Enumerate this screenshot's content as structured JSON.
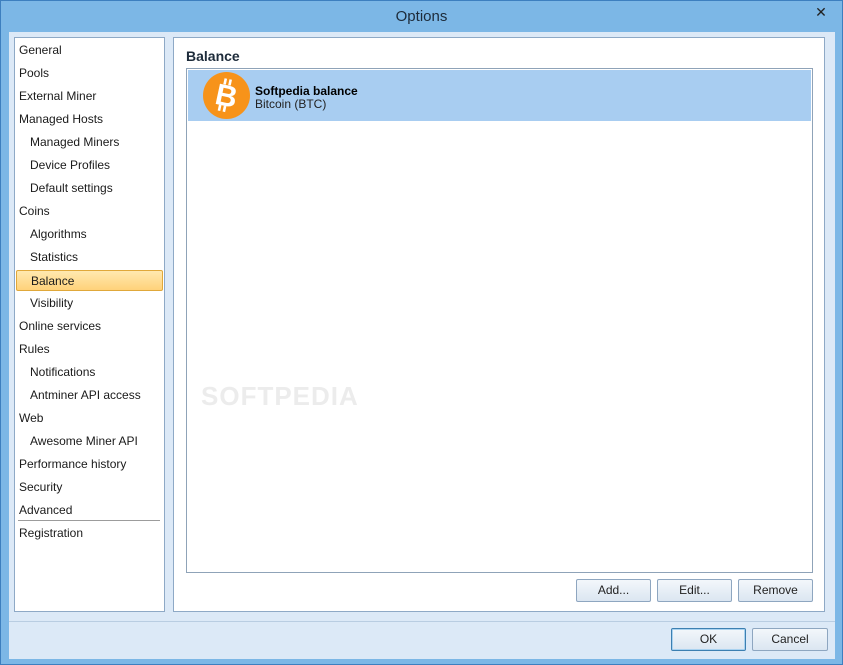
{
  "window": {
    "title": "Options",
    "close_glyph": "✕"
  },
  "nav": {
    "items": [
      {
        "label": "General",
        "level": 0
      },
      {
        "label": "Pools",
        "level": 0
      },
      {
        "label": "External Miner",
        "level": 0
      },
      {
        "label": "Managed Hosts",
        "level": 0
      },
      {
        "label": "Managed Miners",
        "level": 1
      },
      {
        "label": "Device Profiles",
        "level": 1
      },
      {
        "label": "Default settings",
        "level": 1
      },
      {
        "label": "Coins",
        "level": 0
      },
      {
        "label": "Algorithms",
        "level": 1
      },
      {
        "label": "Statistics",
        "level": 1
      },
      {
        "label": "Balance",
        "level": 1,
        "selected": true
      },
      {
        "label": "Visibility",
        "level": 1
      },
      {
        "label": "Online services",
        "level": 0
      },
      {
        "label": "Rules",
        "level": 0
      },
      {
        "label": "Notifications",
        "level": 1
      },
      {
        "label": "Antminer API access",
        "level": 1
      },
      {
        "label": "Web",
        "level": 0
      },
      {
        "label": "Awesome Miner API",
        "level": 1
      },
      {
        "label": "Performance history",
        "level": 0
      },
      {
        "label": "Security",
        "level": 0
      },
      {
        "label": "Advanced",
        "level": 0
      },
      {
        "label": "Registration",
        "level": 0
      }
    ]
  },
  "panel": {
    "title": "Balance",
    "rows": [
      {
        "name": "Softpedia balance",
        "coin": "Bitcoin (BTC)",
        "icon": "bitcoin-icon",
        "icon_color": "#f7931a"
      }
    ],
    "buttons": {
      "add": "Add...",
      "edit": "Edit...",
      "remove": "Remove"
    }
  },
  "footer": {
    "ok": "OK",
    "cancel": "Cancel"
  },
  "watermark": "SOFTPEDIA",
  "colors": {
    "selection": "#a8cdf1",
    "nav_selected": "#ffd27a",
    "frame": "#7cb7e6"
  }
}
